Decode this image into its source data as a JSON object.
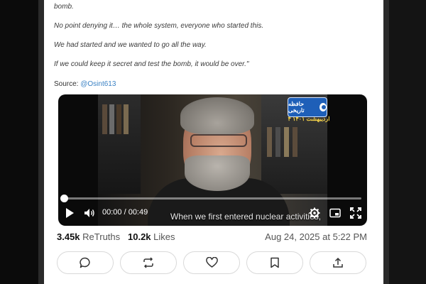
{
  "post": {
    "lines": [
      "bomb.",
      "No point denying it… the whole system, everyone who started this.",
      "We had started and we wanted to go all the way.",
      "If we could keep it secret and test the bomb, it would be over.\""
    ],
    "source_label": "Source:",
    "source_handle": "@Osint613"
  },
  "video": {
    "channel_logo_text": "حافظه تاریخی",
    "channel_date_text": "۴ اردیبهشت ۱۴۰۱",
    "subtitle": "When we first entered nuclear activities,",
    "time_display": "00:00 / 00:49",
    "progress": 0
  },
  "stats": {
    "retruths_count": "3.45k",
    "retruths_label": "ReTruths",
    "likes_count": "10.2k",
    "likes_label": "Likes",
    "date": "Aug 24, 2025 at 5:22 PM"
  },
  "icons": {
    "play": "play-icon",
    "volume": "volume-icon",
    "settings": "gear-icon",
    "pip": "picture-in-picture-icon",
    "fullscreen": "fullscreen-icon",
    "reply": "reply-bubble-icon",
    "retruth": "retruth-arrows-icon",
    "like": "heart-icon",
    "bookmark": "bookmark-icon",
    "share": "share-icon"
  },
  "colors": {
    "link": "#3b82c4",
    "logo_blue": "#1e5fb8",
    "logo_date": "#f5d34a"
  }
}
